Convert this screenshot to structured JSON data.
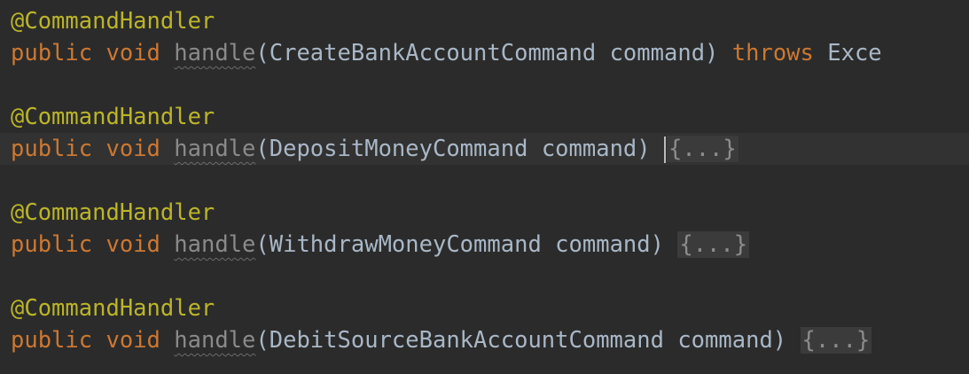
{
  "blocks": [
    {
      "annotation": "@CommandHandler",
      "modifier": "public",
      "return_type": "void",
      "method": "handle",
      "open_paren": "(",
      "param_type": "CreateBankAccountCommand",
      "param_name": "command",
      "close_paren": ")",
      "throws_kw": "throws",
      "exception": "Exce"
    },
    {
      "annotation": "@CommandHandler",
      "modifier": "public",
      "return_type": "void",
      "method": "handle",
      "open_paren": "(",
      "param_type": "DepositMoneyCommand",
      "param_name": "command",
      "close_paren": ")",
      "folded": "{...}"
    },
    {
      "annotation": "@CommandHandler",
      "modifier": "public",
      "return_type": "void",
      "method": "handle",
      "open_paren": "(",
      "param_type": "WithdrawMoneyCommand",
      "param_name": "command",
      "close_paren": ")",
      "folded": "{...}"
    },
    {
      "annotation": "@CommandHandler",
      "modifier": "public",
      "return_type": "void",
      "method": "handle",
      "open_paren": "(",
      "param_type": "DebitSourceBankAccountCommand",
      "param_name": "command",
      "close_paren": ")",
      "folded": "{...}"
    }
  ],
  "colors": {
    "background": "#2b2b2b",
    "current_line": "#323232",
    "annotation": "#bbb529",
    "keyword": "#cc7832",
    "identifier": "#a9b7c6",
    "unused_method": "#8a8a8a",
    "folded_region": "#3b3b3b"
  }
}
